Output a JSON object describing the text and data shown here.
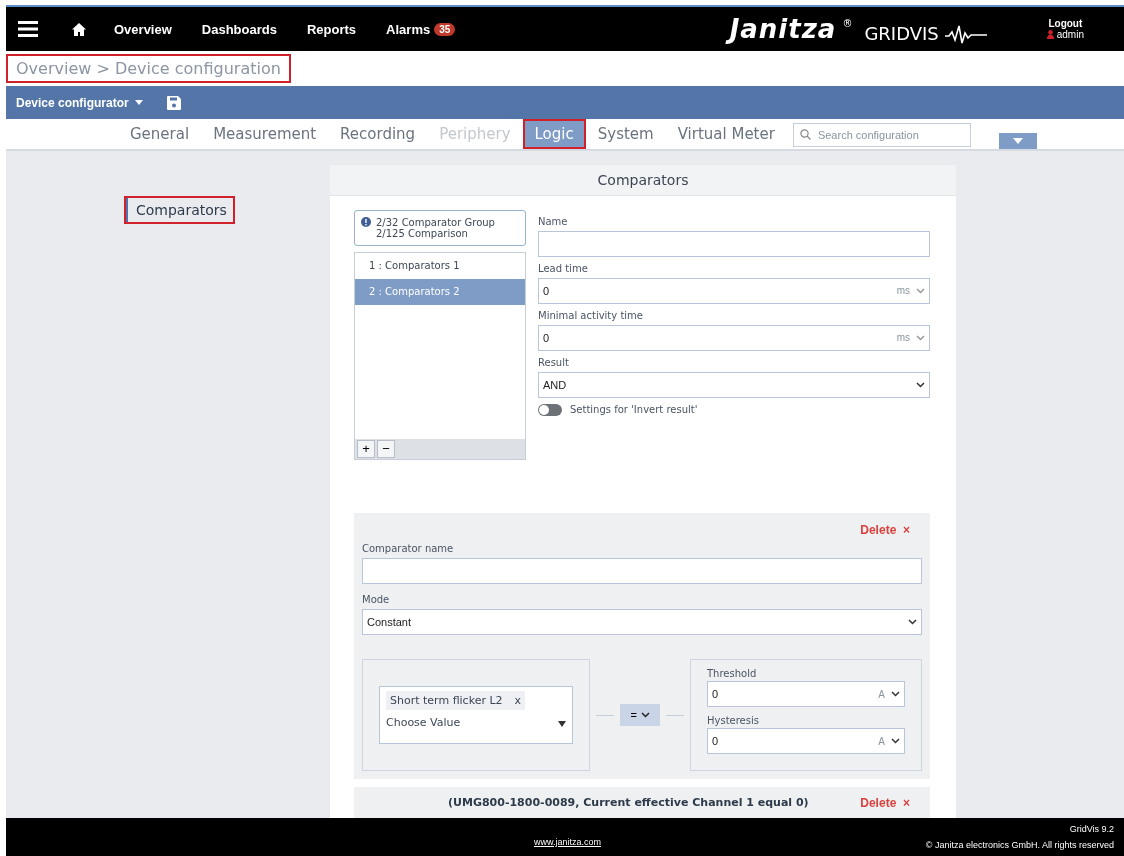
{
  "topbar": {
    "nav": [
      {
        "label": "Overview"
      },
      {
        "label": "Dashboards"
      },
      {
        "label": "Reports"
      },
      {
        "label": "Alarms",
        "badge": "35"
      }
    ],
    "logo": {
      "brand": "Janitza",
      "reg": "®",
      "product": "GRIDVIS"
    },
    "logout": "Logout",
    "user": "admin"
  },
  "breadcrumb": {
    "items": [
      "Overview",
      "Device configuration"
    ],
    "separator": ">",
    "highlighted": true
  },
  "toolbar": {
    "menu": "Device configurator"
  },
  "tabs": [
    {
      "label": "General",
      "selected": false,
      "disabled": false,
      "highlighted": false
    },
    {
      "label": "Measurement",
      "selected": false,
      "disabled": false,
      "highlighted": false
    },
    {
      "label": "Recording",
      "selected": false,
      "disabled": false,
      "highlighted": false
    },
    {
      "label": "Periphery",
      "selected": false,
      "disabled": true,
      "highlighted": false
    },
    {
      "label": "Logic",
      "selected": true,
      "disabled": false,
      "highlighted": true
    },
    {
      "label": "System",
      "selected": false,
      "disabled": false,
      "highlighted": false
    },
    {
      "label": "Virtual Meter",
      "selected": false,
      "disabled": false,
      "highlighted": false
    }
  ],
  "search": {
    "placeholder": "Search configuration"
  },
  "sidebar": {
    "items": [
      {
        "label": "Comparators",
        "selected": true,
        "highlighted": true
      }
    ]
  },
  "panel": {
    "title": "Comparators",
    "info": [
      "2/32 Comparator Group",
      "2/125 Comparison"
    ],
    "groups": [
      {
        "label": "1 : Comparators 1",
        "selected": false
      },
      {
        "label": "2 : Comparators 2",
        "selected": true
      }
    ],
    "add": "+",
    "remove": "−",
    "fields": [
      {
        "label": "Name",
        "kind": "text"
      },
      {
        "label": "Lead time",
        "value": "0",
        "unit": "ms",
        "kind": "unit"
      },
      {
        "label": "Minimal activity time",
        "value": "0",
        "unit": "ms",
        "kind": "unit"
      },
      {
        "label": "Result",
        "value": "AND",
        "kind": "select"
      }
    ],
    "invert": {
      "label": "Settings for 'Invert result'",
      "on": false
    },
    "comparator": {
      "delete": "Delete",
      "delete_mark": "×",
      "name_label": "Comparator name",
      "mode_label": "Mode",
      "mode": "Constant",
      "tag": "Short term flicker L2",
      "tag_remove": "x",
      "choose": "Choose Value",
      "operator": "=",
      "threshold_label": "Threshold",
      "threshold": "0",
      "threshold_unit": "A",
      "hysteresis_label": "Hysteresis",
      "hysteresis": "0",
      "hysteresis_unit": "A"
    },
    "summary": {
      "text": "(UMG800-1800-0089, Current effective Channel 1 equal 0)",
      "delete": "Delete",
      "delete_mark": "×"
    }
  },
  "footer": {
    "link": "www.janitza.com",
    "version": "GridVis 9.2",
    "copyright": "© Janitza electronics GmbH. All rights reserved"
  }
}
